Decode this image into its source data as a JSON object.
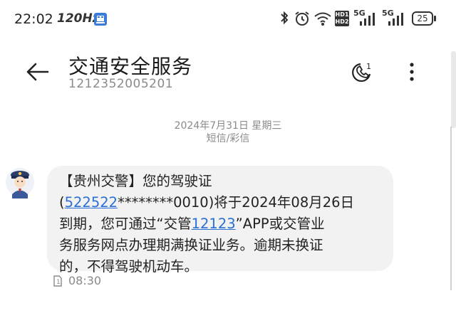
{
  "status_bar": {
    "time": "22:02",
    "refresh_rate": "120Hz",
    "battery": "25",
    "network_5g": "5G",
    "hd1": "HD1",
    "hd2": "HD2"
  },
  "header": {
    "title": "交通安全服务",
    "number": "1212352005201"
  },
  "thread": {
    "date": "2024年7月31日 星期三",
    "type": "短信/彩信"
  },
  "message": {
    "line1": "【贵州交警】您的驾驶证",
    "link_id": "522522",
    "masked_suffix": "********0010)将于2024年08月26日",
    "paren_open": "(",
    "line3_pre": "到期，您可通过“交管",
    "link_app": "12123",
    "line3_post": "”APP或交管业",
    "line4": "务服务网点办理期满换证业务。逾期未换证",
    "line5": "的，不得驾驶机动车。",
    "time": "08:30",
    "sim": "1"
  },
  "colors": {
    "accent_link": "#2a6fd6",
    "bubble": "#f2f2f2"
  },
  "icons": {
    "back": "back-arrow-icon",
    "call": "call-icon",
    "more": "more-vert-icon"
  }
}
